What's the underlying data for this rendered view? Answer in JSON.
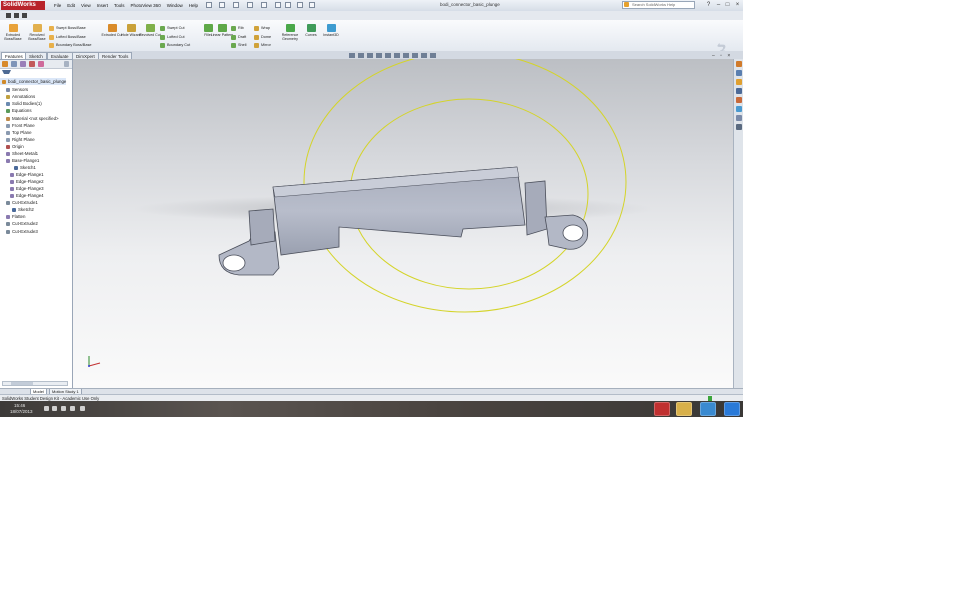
{
  "app": {
    "logo": "SolidWorks",
    "menu": [
      "File",
      "Edit",
      "View",
      "Insert",
      "Tools",
      "PhotoView 360",
      "Window",
      "Help"
    ],
    "document_title": "bodi_connector_basic_plunge",
    "search_placeholder": "Search SolidWorks Help"
  },
  "commands": {
    "extruded_boss": "Extruded Boss/Base",
    "revolved_boss": "Revolved Boss/Base",
    "swept_boss": "Swept Boss/Base",
    "lofted_boss": "Lofted Boss/Base",
    "boundary_boss": "Boundary Boss/Base",
    "extruded_cut": "Extruded Cut",
    "hole_wizard": "Hole Wizard",
    "revolved_cut": "Revolved Cut",
    "swept_cut": "Swept Cut",
    "lofted_cut": "Lofted Cut",
    "boundary_cut": "Boundary Cut",
    "fillet": "Fillet",
    "linear_pattern": "Linear Pattern",
    "rib": "Rib",
    "draft": "Draft",
    "shell": "Shell",
    "wrap": "Wrap",
    "dome": "Dome",
    "mirror": "Mirror",
    "reference_geometry": "Reference Geometry",
    "curves": "Curves",
    "instant3d": "Instant3D"
  },
  "tabs": [
    "Features",
    "Sketch",
    "Evaluate",
    "DimXpert",
    "Render Tools"
  ],
  "tree": [
    "bodi_connector_basic_plunge",
    "Sensors",
    "Annotations",
    "Solid Bodies(1)",
    "Equations",
    "Material <not specified>",
    "Front Plane",
    "Top Plane",
    "Right Plane",
    "Origin",
    "Sheet-Metal1",
    "Base-Flange1",
    "Sketch1",
    "Edge-Flange1",
    "Edge-Flange2",
    "Edge-Flange3",
    "Edge-Flange4",
    "Cut-Extrude1",
    "Sketch2",
    "Flatten",
    "Cut-Extrude2",
    "Cut-Extrude3"
  ],
  "model_tabs": [
    "Model",
    "Motion Study 1"
  ],
  "status": "SolidWorks Student Design Kit - Academic Use Only",
  "taskbar": {
    "time": "15:46",
    "date": "18/07/2013"
  },
  "colors": {
    "part": "#b8bdcb",
    "part_shadow": "#8e94a4",
    "circle": "#d4d42a",
    "title_red": "#b8232a"
  }
}
